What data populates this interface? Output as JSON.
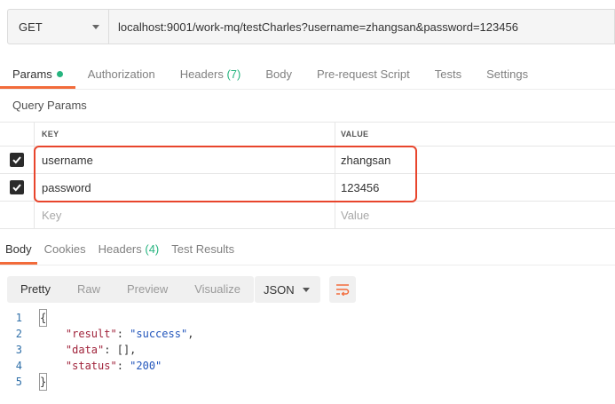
{
  "request": {
    "method": "GET",
    "url": "localhost:9001/work-mq/testCharles?username=zhangsan&password=123456"
  },
  "req_tabs": [
    {
      "label": "Params"
    },
    {
      "label": "Authorization"
    },
    {
      "label": "Headers",
      "count": "(7)"
    },
    {
      "label": "Body"
    },
    {
      "label": "Pre-request Script"
    },
    {
      "label": "Tests"
    },
    {
      "label": "Settings"
    }
  ],
  "params": {
    "title": "Query Params",
    "columns": {
      "key": "KEY",
      "value": "VALUE"
    },
    "rows": [
      {
        "key": "username",
        "value": "zhangsan",
        "checked": true
      },
      {
        "key": "password",
        "value": "123456",
        "checked": true
      }
    ],
    "placeholder": {
      "key": "Key",
      "value": "Value"
    }
  },
  "res_tabs": [
    {
      "label": "Body"
    },
    {
      "label": "Cookies"
    },
    {
      "label": "Headers",
      "count": "(4)"
    },
    {
      "label": "Test Results"
    }
  ],
  "view_options": [
    "Pretty",
    "Raw",
    "Preview",
    "Visualize"
  ],
  "format": "JSON",
  "code": {
    "line_numbers": [
      "1",
      "2",
      "3",
      "4",
      "5"
    ],
    "open_brace": "{",
    "close_brace": "}",
    "entries": [
      {
        "key": "\"result\"",
        "sep": ": ",
        "value": "\"success\"",
        "trail": ","
      },
      {
        "key": "\"data\"",
        "sep": ": ",
        "value": "[]",
        "trail": ","
      },
      {
        "key": "\"status\"",
        "sep": ": ",
        "value": "\"200\"",
        "trail": ""
      }
    ]
  },
  "colors": {
    "accent": "#f26b3a",
    "success": "#26b47f",
    "highlight": "#e8452c"
  }
}
